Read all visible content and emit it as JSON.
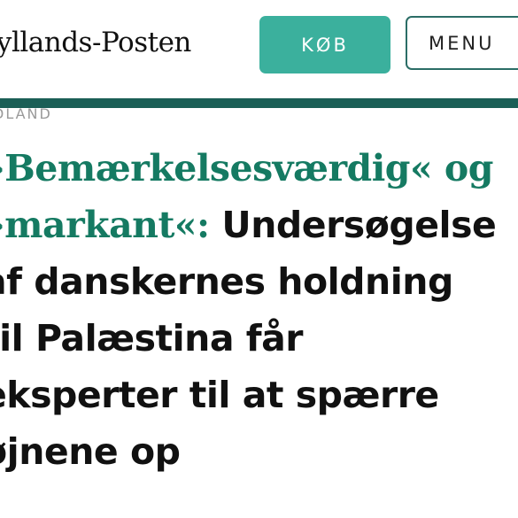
{
  "header": {
    "logo": "Jyllands-Posten",
    "buy_label": "KØB",
    "menu_label": "MENU"
  },
  "article": {
    "kicker": "DLAND",
    "headline": {
      "quote1": "»Bemærkelsesværdig« og",
      "quote2": "»markant«:",
      "rest_line2": " Undersøgelse",
      "line3": "af danskernes holdning",
      "line4": "til Palæstina får",
      "line5": "eksperter til at spærre",
      "line6": "øjnene op"
    }
  },
  "colors": {
    "accent": "#157a62",
    "button": "#3bb09d",
    "rule": "#1b5f56"
  }
}
